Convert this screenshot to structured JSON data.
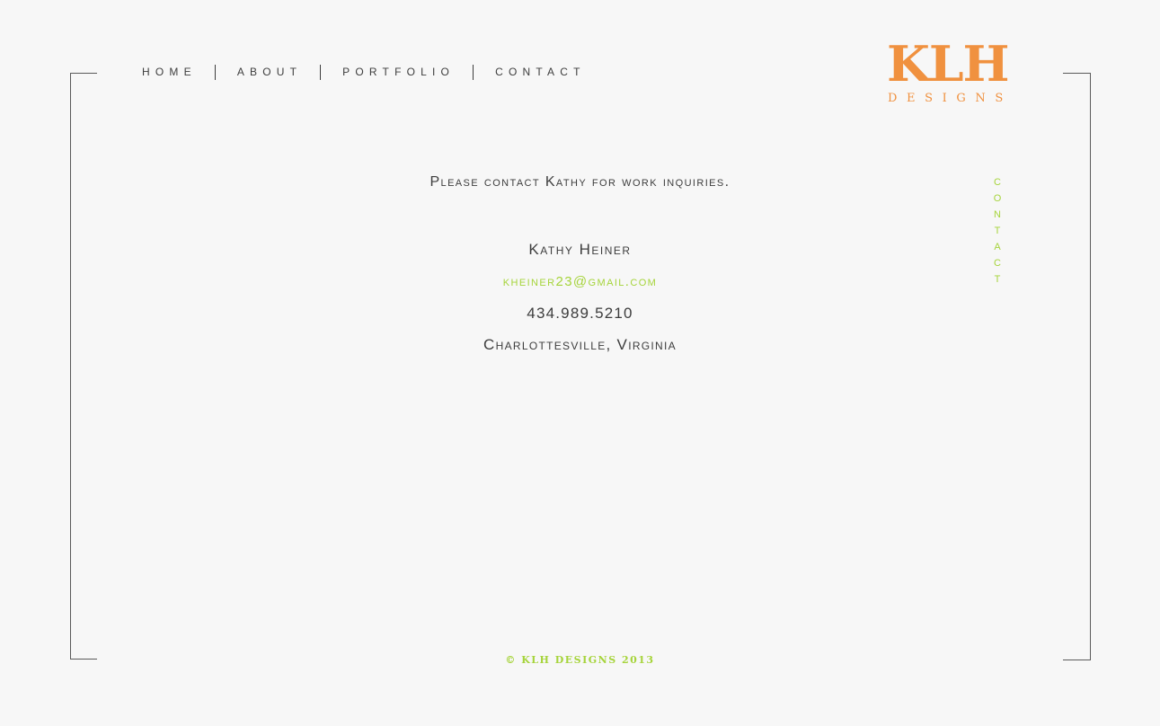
{
  "nav": {
    "items": [
      {
        "label": "HOME"
      },
      {
        "label": "ABOUT"
      },
      {
        "label": "PORTFOLIO"
      },
      {
        "label": "CONTACT"
      }
    ]
  },
  "logo": {
    "mark": "KLH",
    "subtitle": "DESIGNS"
  },
  "section": {
    "label": "CONTACT"
  },
  "contact": {
    "intro": "Please contact Kathy for work inquiries.",
    "name": "Kathy Heiner",
    "email": "kheiner23@gmail.com",
    "phone": "434.989.5210",
    "location": "Charlottesville, Virginia"
  },
  "footer": {
    "copyright": "© KLH DESIGNS 2013"
  },
  "colors": {
    "accent_orange": "#f0913f",
    "accent_green": "#a6d43b",
    "text": "#3d3d3d",
    "background": "#f7f7f7"
  }
}
